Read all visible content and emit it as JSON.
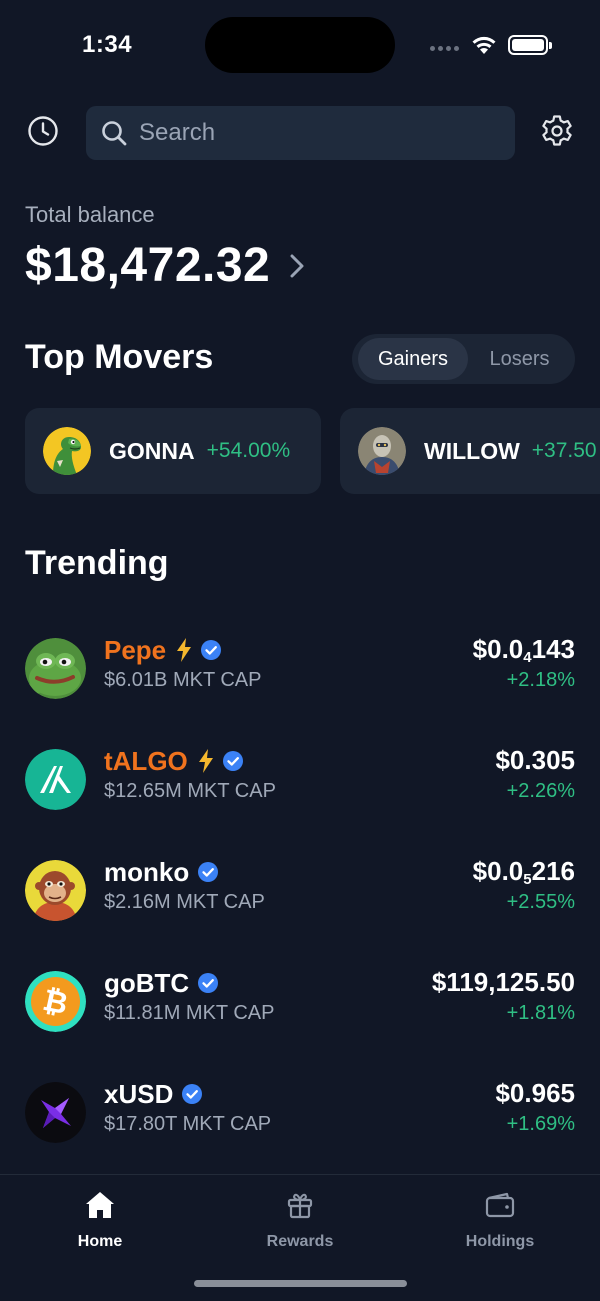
{
  "status": {
    "time": "1:34",
    "icons": [
      "cellular-signal-icon",
      "wifi-icon",
      "battery-icon"
    ]
  },
  "header": {
    "history_icon": "clock-icon",
    "search_placeholder": "Search",
    "settings_icon": "gear-icon"
  },
  "balance": {
    "label": "Total balance",
    "amount": "$18,472.32"
  },
  "movers": {
    "title": "Top Movers",
    "segments": [
      "Gainers",
      "Losers"
    ],
    "selected_segment": "Gainers",
    "items": [
      {
        "name": "GONNA",
        "change": "+54.00%",
        "avatar": "dinosaur-avatar"
      },
      {
        "name": "WILLOW",
        "change": "+37.50",
        "avatar": "robot-avatar"
      }
    ]
  },
  "trending": {
    "title": "Trending",
    "items": [
      {
        "name": "Pepe",
        "highlight": true,
        "bolt": true,
        "verified": true,
        "mcap": "$6.01B MKT CAP",
        "price_prefix": "$0.0",
        "price_sub": "4",
        "price_suffix": "143",
        "change": "+2.18%",
        "avatar": "pepe-frog-avatar"
      },
      {
        "name": "tALGO",
        "highlight": true,
        "bolt": true,
        "verified": true,
        "mcap": "$12.65M MKT CAP",
        "price_prefix": "$0.305",
        "price_sub": "",
        "price_suffix": "",
        "change": "+2.26%",
        "avatar": "algorand-avatar"
      },
      {
        "name": "monko",
        "highlight": false,
        "bolt": false,
        "verified": true,
        "mcap": "$2.16M MKT CAP",
        "price_prefix": "$0.0",
        "price_sub": "5",
        "price_suffix": "216",
        "change": "+2.55%",
        "avatar": "monkey-avatar"
      },
      {
        "name": "goBTC",
        "highlight": false,
        "bolt": false,
        "verified": true,
        "mcap": "$11.81M MKT CAP",
        "price_prefix": "$119,125.50",
        "price_sub": "",
        "price_suffix": "",
        "change": "+1.81%",
        "avatar": "bitcoin-avatar"
      },
      {
        "name": "xUSD",
        "highlight": false,
        "bolt": false,
        "verified": true,
        "mcap": "$17.80T MKT CAP",
        "price_prefix": "$0.965",
        "price_sub": "",
        "price_suffix": "",
        "change": "+1.69%",
        "avatar": "xusd-avatar"
      }
    ]
  },
  "tabbar": {
    "tabs": [
      {
        "label": "Home",
        "icon": "house-icon",
        "active": true
      },
      {
        "label": "Rewards",
        "icon": "gift-icon",
        "active": false
      },
      {
        "label": "Holdings",
        "icon": "wallet-icon",
        "active": false
      }
    ]
  },
  "colors": {
    "background": "#111726",
    "card": "#1c2535",
    "positive": "#2fbf84",
    "highlight_name": "#f0731e",
    "verified": "#3b82f6",
    "bolt": "#f5b82e"
  }
}
